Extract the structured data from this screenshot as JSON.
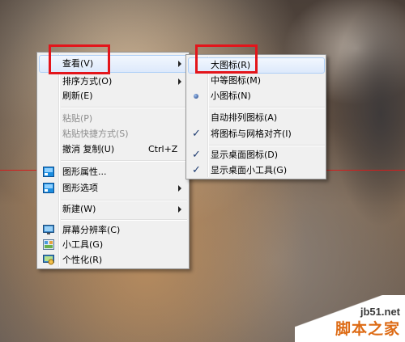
{
  "main_menu": {
    "items": [
      {
        "label": "查看(V)",
        "submenu": true,
        "highlighted": true
      },
      {
        "label": "排序方式(O)",
        "submenu": true
      },
      {
        "label": "刷新(E)"
      },
      {
        "label": "粘贴(P)",
        "disabled": true
      },
      {
        "label": "粘贴快捷方式(S)",
        "disabled": true
      },
      {
        "label": "撤消 复制(U)",
        "shortcut": "Ctrl+Z"
      },
      {
        "label": "图形属性...",
        "icon": "graphics-properties-icon"
      },
      {
        "label": "图形选项",
        "icon": "graphics-options-icon",
        "submenu": true
      },
      {
        "label": "新建(W)",
        "submenu": true
      },
      {
        "label": "屏幕分辨率(C)",
        "icon": "screen-resolution-icon"
      },
      {
        "label": "小工具(G)",
        "icon": "gadgets-icon"
      },
      {
        "label": "个性化(R)",
        "icon": "personalize-icon"
      }
    ]
  },
  "view_submenu": {
    "items": [
      {
        "label": "大图标(R)",
        "highlighted": true
      },
      {
        "label": "中等图标(M)"
      },
      {
        "label": "小图标(N)",
        "selected_radio": true
      },
      {
        "label": "自动排列图标(A)"
      },
      {
        "label": "将图标与网格对齐(I)",
        "checked": true
      },
      {
        "label": "显示桌面图标(D)",
        "checked": true
      },
      {
        "label": "显示桌面小工具(G)",
        "checked": true
      }
    ]
  },
  "watermark": {
    "site": "jb51.net",
    "name": "脚本之家"
  },
  "colors": {
    "annotation_red": "#e3151b",
    "menu_bg": "#f0f0f0",
    "highlight_border": "#aecff7"
  }
}
